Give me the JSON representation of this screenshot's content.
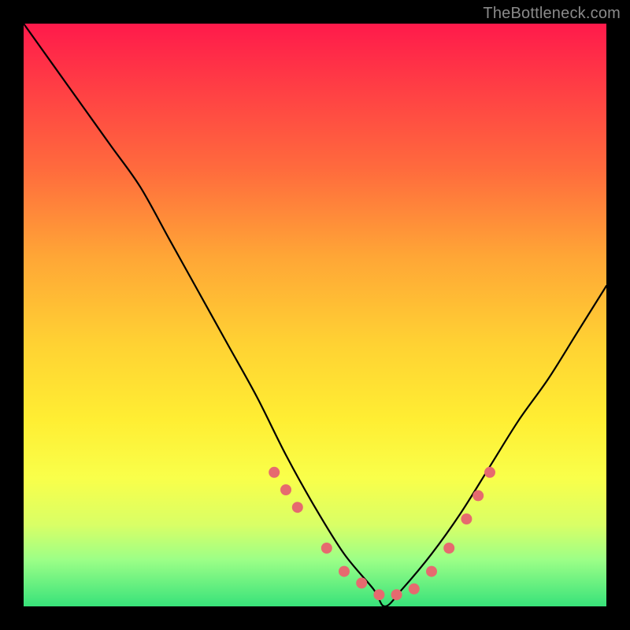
{
  "watermark": "TheBottleneck.com",
  "chart_data": {
    "type": "line",
    "title": "",
    "xlabel": "",
    "ylabel": "",
    "xlim": [
      0,
      100
    ],
    "ylim": [
      0,
      100
    ],
    "series": [
      {
        "name": "curve",
        "x": [
          0,
          5,
          10,
          15,
          20,
          25,
          30,
          35,
          40,
          45,
          50,
          55,
          60,
          62,
          65,
          70,
          75,
          80,
          85,
          90,
          95,
          100
        ],
        "y": [
          100,
          93,
          86,
          79,
          72,
          63,
          54,
          45,
          36,
          26,
          17,
          9,
          3,
          0,
          3,
          9,
          16,
          24,
          32,
          39,
          47,
          55
        ]
      }
    ],
    "markers": {
      "name": "highlight-dots",
      "color": "#e66a6f",
      "x": [
        43,
        45,
        47,
        52,
        55,
        58,
        61,
        64,
        67,
        70,
        73,
        76,
        78,
        80
      ],
      "y": [
        23,
        20,
        17,
        10,
        6,
        4,
        2,
        2,
        3,
        6,
        10,
        15,
        19,
        23
      ]
    }
  }
}
